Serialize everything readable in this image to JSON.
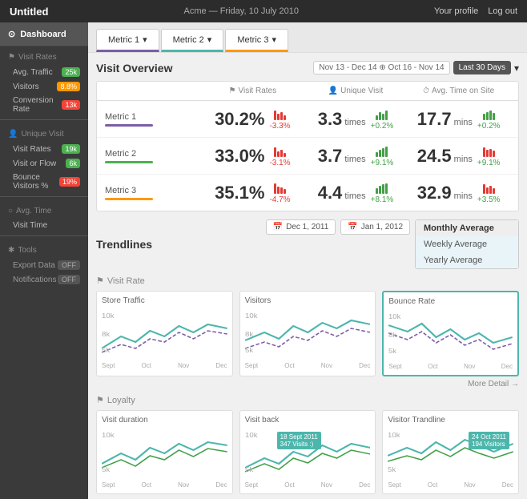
{
  "header": {
    "title": "Untitled",
    "center": "Acme — Friday, 10 July 2010",
    "profile": "Your profile",
    "logout": "Log out"
  },
  "sidebar": {
    "dashboard_label": "Dashboard",
    "sections": [
      {
        "name": "Visit Rates",
        "icon": "flag",
        "items": [
          {
            "label": "Avg. Traffic",
            "badge": "25k",
            "badge_type": "green"
          },
          {
            "label": "Visitors",
            "badge": "8.8%",
            "badge_type": "orange"
          },
          {
            "label": "Conversion Rate",
            "badge": "13k",
            "badge_type": "red"
          }
        ]
      },
      {
        "name": "Unique Visit",
        "icon": "person",
        "items": [
          {
            "label": "Visit Rates",
            "badge": "19k",
            "badge_type": "green"
          },
          {
            "label": "Visit or Flow",
            "badge": "6k",
            "badge_type": "green"
          },
          {
            "label": "Bounce Visitors %",
            "badge": "19%",
            "badge_type": "red"
          }
        ]
      },
      {
        "name": "Avg. Time",
        "icon": "clock",
        "items": [
          {
            "label": "Visit Time",
            "badge": "",
            "badge_type": ""
          }
        ]
      },
      {
        "name": "Tools",
        "icon": "tools",
        "items": [
          {
            "label": "Export Data",
            "toggle": "OFF"
          },
          {
            "label": "Notifications",
            "toggle": "OFF"
          }
        ]
      }
    ]
  },
  "metric_tabs": [
    {
      "label": "Metric 1",
      "active_class": "active-purple"
    },
    {
      "label": "Metric 2",
      "active_class": "active-teal"
    },
    {
      "label": "Metric 3",
      "active_class": "active-orange"
    }
  ],
  "visit_overview": {
    "title": "Visit Overview",
    "date_filters": [
      "Nov 13 - Dec 14",
      "Oct 16 - Nov 14"
    ],
    "last_period": "Last 30 Days",
    "col_headers": [
      "Visit Rates",
      "Unique Visit",
      "Avg. Time on Site"
    ],
    "rows": [
      {
        "label": "Metric 1",
        "line_class": "line-purple",
        "visit_rate": "30.2%",
        "visit_rate_change": "-3.3%",
        "visit_rate_dir": "neg",
        "unique_visit": "3.3",
        "unique_unit": "times",
        "unique_change": "+0.2%",
        "unique_dir": "pos",
        "avg_time": "17.7",
        "avg_unit": "mins",
        "avg_change": "+0.2%",
        "avg_dir": "pos"
      },
      {
        "label": "Metric 2",
        "line_class": "line-green",
        "visit_rate": "33.0%",
        "visit_rate_change": "-3.1%",
        "visit_rate_dir": "neg",
        "unique_visit": "3.7",
        "unique_unit": "times",
        "unique_change": "+9.1%",
        "unique_dir": "pos",
        "avg_time": "24.5",
        "avg_unit": "mins",
        "avg_change": "+9.1%",
        "avg_dir": "pos"
      },
      {
        "label": "Metric 3",
        "line_class": "line-orange",
        "visit_rate": "35.1%",
        "visit_rate_change": "-4.7%",
        "visit_rate_dir": "neg",
        "unique_visit": "4.4",
        "unique_unit": "times",
        "unique_change": "+8.1%",
        "unique_dir": "pos",
        "avg_time": "32.9",
        "avg_unit": "mins",
        "avg_change": "+3.5%",
        "avg_dir": "pos"
      }
    ]
  },
  "trendlines": {
    "title": "Trendlines",
    "start_date": "Dec 1, 2011",
    "end_date": "Jan 1, 2012",
    "dropdown_options": [
      "Monthly Average",
      "Weekly Average",
      "Yearly Average"
    ],
    "selected_option": "Monthly Average",
    "visit_rate_label": "Visit Rate",
    "charts_row1": [
      {
        "title": "Store Traffic",
        "highlighted": false
      },
      {
        "title": "Visitors",
        "highlighted": false
      },
      {
        "title": "Bounce Rate",
        "highlighted": true
      }
    ],
    "more_detail": "More Detail →",
    "loyalty_label": "Loyalty",
    "charts_row2": [
      {
        "title": "Visit duration",
        "tooltip": null
      },
      {
        "title": "Visit back",
        "tooltip": "18 Sept 2011\n347 Visits :)"
      },
      {
        "title": "Visitor Trandline",
        "tooltip": "24 Oct 2011\n194 Visitors"
      }
    ],
    "x_labels": [
      "Sept",
      "Oct",
      "Nov",
      "Dec"
    ]
  }
}
